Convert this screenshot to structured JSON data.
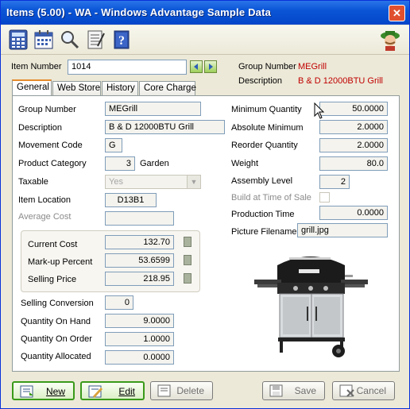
{
  "window": {
    "title": "Items (5.00) - WA - Windows Advantage Sample Data",
    "close_label": "✕"
  },
  "header": {
    "item_number_label": "Item Number",
    "item_number_value": "1014",
    "group_number_label": "Group Number",
    "group_number_value": "MEGrill",
    "description_label": "Description",
    "description_value": "B & D 12000BTU Grill"
  },
  "tabs": [
    {
      "label": "General"
    },
    {
      "label": "Web Store"
    },
    {
      "label": "History"
    },
    {
      "label": "Core Charge"
    }
  ],
  "general": {
    "group_number_label": "Group Number",
    "group_number_value": "MEGrill",
    "description_label": "Description",
    "description_value": "B & D 12000BTU Grill",
    "movement_code_label": "Movement Code",
    "movement_code_value": "G",
    "product_category_label": "Product Category",
    "product_category_value": "3",
    "product_category_name": "Garden",
    "taxable_label": "Taxable",
    "taxable_value": "Yes",
    "item_location_label": "Item Location",
    "item_location_value": "D13B1",
    "average_cost_label": "Average Cost",
    "average_cost_value": "",
    "current_cost_label": "Current Cost",
    "current_cost_value": "132.70",
    "markup_percent_label": "Mark-up Percent",
    "markup_percent_value": "53.6599",
    "selling_price_label": "Selling Price",
    "selling_price_value": "218.95",
    "selling_conversion_label": "Selling Conversion",
    "selling_conversion_value": "0",
    "quantity_on_hand_label": "Quantity On Hand",
    "quantity_on_hand_value": "9.0000",
    "quantity_on_order_label": "Quantity On Order",
    "quantity_on_order_value": "1.0000",
    "quantity_allocated_label": "Quantity Allocated",
    "quantity_allocated_value": "0.0000",
    "minimum_quantity_label": "Minimum Quantity",
    "minimum_quantity_value": "50.0000",
    "absolute_minimum_label": "Absolute Minimum",
    "absolute_minimum_value": "2.0000",
    "reorder_quantity_label": "Reorder Quantity",
    "reorder_quantity_value": "2.0000",
    "weight_label": "Weight",
    "weight_value": "80.0",
    "assembly_level_label": "Assembly Level",
    "assembly_level_value": "2",
    "build_at_time_of_sale_label": "Build at Time of Sale",
    "production_time_label": "Production Time",
    "production_time_value": "0.0000",
    "picture_filename_label": "Picture Filename",
    "picture_filename_value": "grill.jpg"
  },
  "buttons": {
    "new_label": "New",
    "edit_label": "Edit",
    "delete_label": "Delete",
    "save_label": "Save",
    "cancel_label": "Cancel"
  },
  "colors": {
    "titlebar": "#0a55d6",
    "accent_red": "#c00000",
    "tab_highlight": "#e68b2c"
  }
}
